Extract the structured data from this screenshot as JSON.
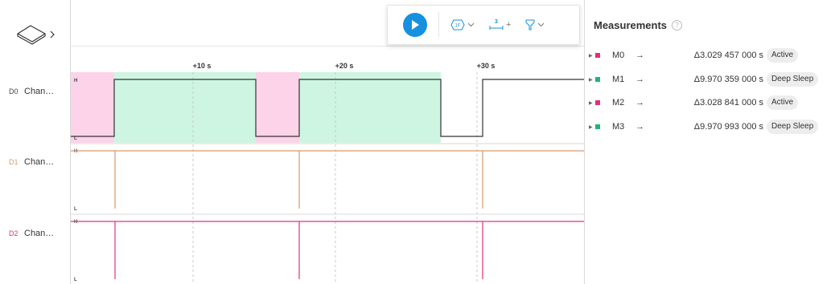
{
  "toolbar": {
    "icons": [
      "play-icon",
      "trigger-icon",
      "measure-add-icon",
      "filter-icon"
    ],
    "trigger_label": "1F",
    "measure_count": "3",
    "measure_plus": "+"
  },
  "time_axis": {
    "ticks": [
      "+10 s",
      "+20 s",
      "+30 s"
    ]
  },
  "channels": [
    {
      "id": "D0",
      "name": "Chan…",
      "color": "#444444",
      "high_label": "H",
      "low_label": "L"
    },
    {
      "id": "D1",
      "name": "Chan…",
      "color": "#d69a6e",
      "high_label": "H",
      "low_label": "L"
    },
    {
      "id": "D2",
      "name": "Chan…",
      "color": "#e0307a",
      "high_label": "H",
      "low_label": "L"
    }
  ],
  "measurements": {
    "title": "Measurements",
    "help": "?",
    "items": [
      {
        "label": "M0",
        "arrow": "→",
        "delta": "Δ3.029 457 000 s",
        "badge": "Active",
        "color": "#e0307a"
      },
      {
        "label": "M1",
        "arrow": "→",
        "delta": "Δ9.970 359 000 s",
        "badge": "Deep Sleep",
        "color": "#22b573"
      },
      {
        "label": "M2",
        "arrow": "→",
        "delta": "Δ3.028 841 000 s",
        "badge": "Active",
        "color": "#e0307a"
      },
      {
        "label": "M3",
        "arrow": "→",
        "delta": "Δ9.970 993 000 s",
        "badge": "Deep Sleep",
        "color": "#22b573"
      }
    ]
  },
  "colors": {
    "accent": "#1690e0",
    "active_region": "#fcd3e8",
    "sleep_region": "#cdf5e2"
  }
}
